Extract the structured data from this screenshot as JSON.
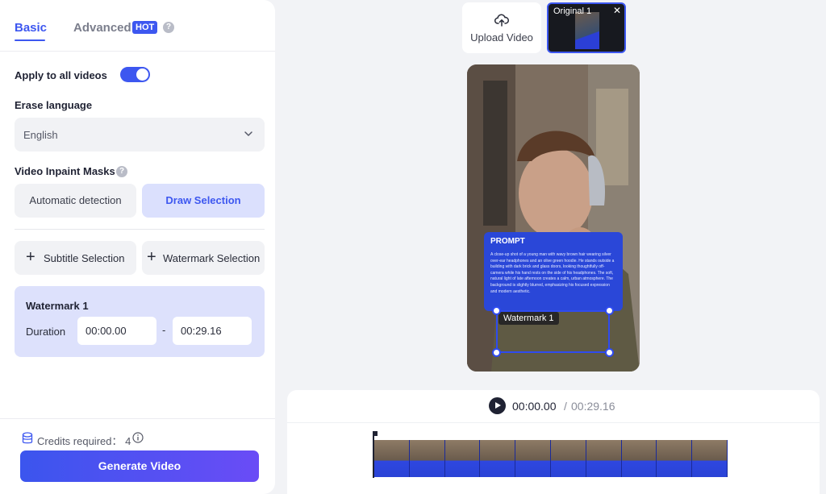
{
  "tabs": {
    "basic": "Basic",
    "advanced": "Advanced",
    "hot_badge": "HOT",
    "help": "?"
  },
  "settings": {
    "apply_all_label": "Apply to all videos",
    "apply_all_on": true,
    "erase_language_label": "Erase language",
    "erase_language_value": "English",
    "inpaint_label": "Video Inpaint Masks",
    "auto_detect": "Automatic detection",
    "draw_selection": "Draw Selection",
    "subtitle_selection": "Subtitle Selection",
    "watermark_selection": "Watermark Selection"
  },
  "watermark": {
    "title": "Watermark 1",
    "duration_label": "Duration",
    "start": "00:00.00",
    "dash": "-",
    "end": "00:29.16"
  },
  "footer": {
    "credits_label": "Credits required： 4",
    "generate": "Generate Video"
  },
  "media": {
    "upload_label": "Upload Video",
    "thumb_label": "Original 1",
    "close": "✕"
  },
  "preview": {
    "prompt_title": "PROMPT",
    "prompt_text": "A close-up shot of a young man with wavy brown hair wearing silver over-ear headphones and an olive green hoodie. He stands outside a building with dark brick and glass doors, looking thoughtfully off-camera while his hand rests on the side of his headphones. The soft, natural light of late afternoon creates a calm, urban atmosphere. The background is slightly blurred, emphasizing his focused expression and modern aesthetic.",
    "mask_label": "Watermark 1"
  },
  "timeline": {
    "current": "00:00.00",
    "sep": "/",
    "total": "00:29.16"
  },
  "colors": {
    "accent": "#3d57f0",
    "selected_bg": "#dbe0fd"
  }
}
